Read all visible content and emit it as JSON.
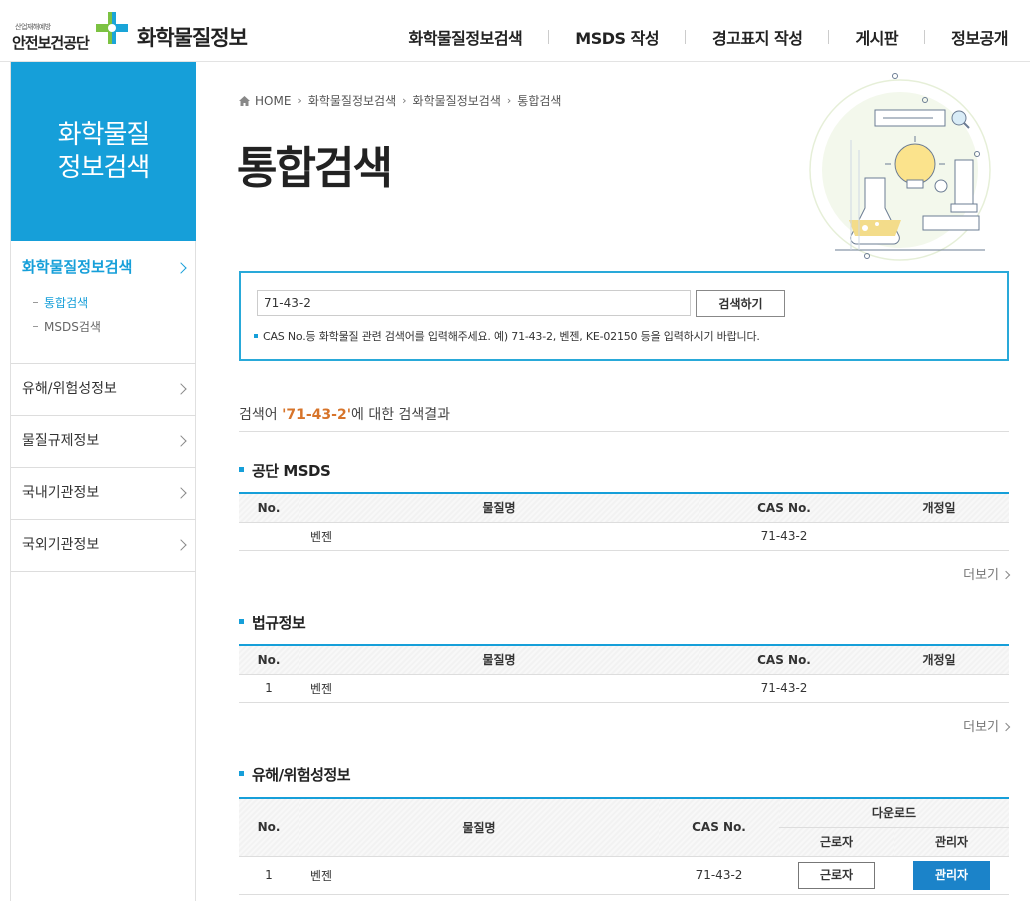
{
  "header": {
    "logo_small": "산업재해예방",
    "logo_main": "안전보건공단",
    "site_title": "화학물질정보",
    "nav": [
      "화학물질정보검색",
      "MSDS 작성",
      "경고표지 작성",
      "게시판",
      "정보공개"
    ]
  },
  "sidebar": {
    "heading": "화학물질\n정보검색",
    "sections": [
      {
        "label": "화학물질정보검색",
        "sub": [
          "통합검색",
          "MSDS검색"
        ]
      },
      {
        "label": "유해/위험성정보"
      },
      {
        "label": "물질규제정보"
      },
      {
        "label": "국내기관정보"
      },
      {
        "label": "국외기관정보"
      }
    ]
  },
  "breadcrumb": [
    "HOME",
    "화학물질정보검색",
    "화학물질정보검색",
    "통합검색"
  ],
  "page_title": "통합검색",
  "search": {
    "value": "71-43-2",
    "button": "검색하기",
    "hint": "CAS No.등 화학물질 관련 검색어를 입력해주세요. 예) 71-43-2, 벤젠, KE-02150 등을 입력하시기 바랍니다."
  },
  "result": {
    "prefix": "검색어 ",
    "term": "'71-43-2'",
    "suffix": "에 대한 검색결과"
  },
  "sections": {
    "msds": {
      "title": "공단 MSDS",
      "headers": [
        "No.",
        "물질명",
        "CAS No.",
        "개정일"
      ],
      "row": {
        "no": "",
        "name": "벤젠",
        "cas": "71-43-2",
        "date": ""
      },
      "more": "더보기"
    },
    "law": {
      "title": "법규정보",
      "headers": [
        "No.",
        "물질명",
        "CAS No.",
        "개정일"
      ],
      "row": {
        "no": "1",
        "name": "벤젠",
        "cas": "71-43-2",
        "date": ""
      },
      "more": "더보기"
    },
    "hazard": {
      "title": "유해/위험성정보",
      "headers": {
        "no": "No.",
        "name": "물질명",
        "cas": "CAS No.",
        "download": "다운로드",
        "worker": "근로자",
        "admin": "관리자"
      },
      "row": {
        "no": "1",
        "name": "벤젠",
        "cas": "71-43-2",
        "worker_btn": "근로자",
        "admin_btn": "관리자"
      }
    }
  },
  "colors": {
    "accent": "#169fd9",
    "term": "#d7742a",
    "admin_button": "#1b83c9"
  }
}
